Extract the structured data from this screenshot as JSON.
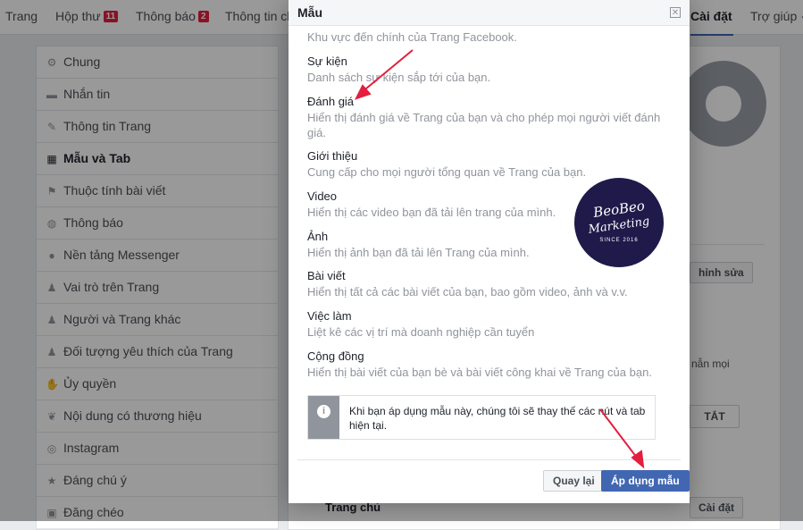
{
  "topnav": {
    "items": [
      "Trang",
      "Hộp thư",
      "Thông báo",
      "Thông tin chi",
      "Cài đặt",
      "Trợ giúp"
    ],
    "inbox_badge": "11",
    "notify_badge": "2"
  },
  "sidebar": {
    "items": [
      {
        "label": "Chung",
        "icon": "gear-icon"
      },
      {
        "label": "Nhắn tin",
        "icon": "message-icon"
      },
      {
        "label": "Thông tin Trang",
        "icon": "pencil-icon"
      },
      {
        "label": "Mẫu và Tab",
        "icon": "grid-icon"
      },
      {
        "label": "Thuộc tính bài viết",
        "icon": "flag-icon"
      },
      {
        "label": "Thông báo",
        "icon": "globe-icon"
      },
      {
        "label": "Nền tảng Messenger",
        "icon": "messenger-icon"
      },
      {
        "label": "Vai trò trên Trang",
        "icon": "person-icon"
      },
      {
        "label": "Người và Trang khác",
        "icon": "people-icon"
      },
      {
        "label": "Đối tượng yêu thích của Trang",
        "icon": "people-icon"
      },
      {
        "label": "Ủy quyền",
        "icon": "wrench-icon"
      },
      {
        "label": "Nội dung có thương hiệu",
        "icon": "handshake-icon"
      },
      {
        "label": "Instagram",
        "icon": "instagram-icon"
      },
      {
        "label": "Đáng chú ý",
        "icon": "star-icon"
      },
      {
        "label": "Đăng chéo",
        "icon": "crosspost-icon"
      }
    ]
  },
  "right": {
    "edit_label": "hỉnh sửa",
    "partial_text": "nẫn mọi",
    "off_label": "TẮT",
    "home_label": "Trang chủ",
    "settings_btn": "Cài đặt"
  },
  "modal": {
    "title": "Mẫu",
    "intro": "Khu vực đến chính của Trang Facebook.",
    "options": [
      {
        "name": "Sự kiện",
        "desc": "Danh sách sự kiện sắp tới của bạn."
      },
      {
        "name": "Đánh giá",
        "desc": "Hiển thị đánh giá về Trang của bạn và cho phép mọi người viết đánh giá."
      },
      {
        "name": "Giới thiệu",
        "desc": "Cung cấp cho mọi người tổng quan về Trang của bạn."
      },
      {
        "name": "Video",
        "desc": "Hiển thị các video bạn đã tải lên trang của mình."
      },
      {
        "name": "Ảnh",
        "desc": "Hiển thị ảnh bạn đã tải lên Trang của mình."
      },
      {
        "name": "Bài viết",
        "desc": "Hiển thị tất cả các bài viết của bạn, bao gồm video, ảnh và v.v."
      },
      {
        "name": "Việc làm",
        "desc": "Liệt kê các vị trí mà doanh nghiệp cần tuyển"
      },
      {
        "name": "Cộng đồng",
        "desc": "Hiển thị bài viết của bạn bè và bài viết công khai về Trang của bạn."
      }
    ],
    "info": "Khi bạn áp dụng mẫu này, chúng tôi sẽ thay thế các nút và tab hiện tại.",
    "back_button": "Quay lại",
    "apply_button": "Áp dụng mẫu"
  },
  "logo": {
    "line1": "BeoBeo",
    "line2": "Marketing",
    "line3": "SINCE 2016"
  },
  "colors": {
    "accent": "#4267b2",
    "arrow": "#e41e3f",
    "logo_bg": "#1f1a4a"
  }
}
